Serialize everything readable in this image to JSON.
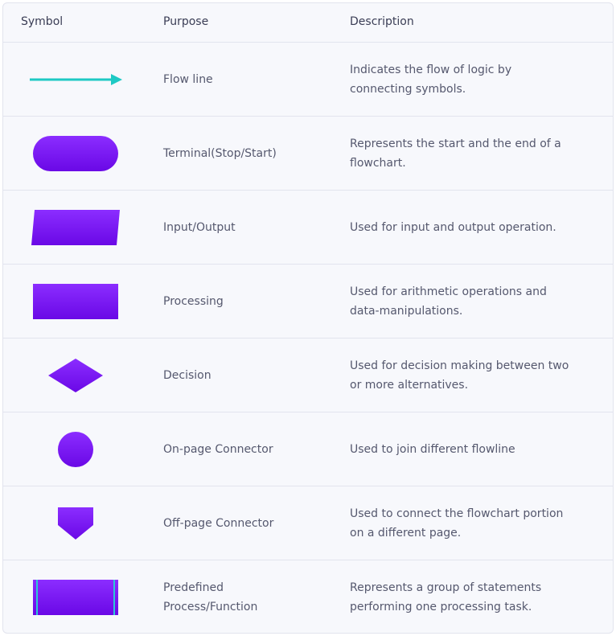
{
  "table": {
    "headers": {
      "symbol": "Symbol",
      "purpose": "Purpose",
      "description": "Description"
    },
    "rows": [
      {
        "symbol_icon": "flow-line-arrow-icon",
        "purpose": [
          "Flow line"
        ],
        "description": [
          "Indicates the flow of logic by",
          "connecting symbols."
        ]
      },
      {
        "symbol_icon": "terminal-icon",
        "purpose": [
          "Terminal(Stop/Start)"
        ],
        "description": [
          "Represents the start and the end of a",
          "flowchart."
        ]
      },
      {
        "symbol_icon": "input-output-icon",
        "purpose": [
          "Input/Output"
        ],
        "description": [
          "Used for input and output operation."
        ]
      },
      {
        "symbol_icon": "processing-icon",
        "purpose": [
          "Processing"
        ],
        "description": [
          "Used for arithmetic operations and",
          "data-manipulations."
        ]
      },
      {
        "symbol_icon": "decision-icon",
        "purpose": [
          "Decision"
        ],
        "description": [
          "Used for decision making between two",
          "or more alternatives."
        ]
      },
      {
        "symbol_icon": "on-page-connector-icon",
        "purpose": [
          "On-page Connector"
        ],
        "description": [
          "Used to join different flowline"
        ]
      },
      {
        "symbol_icon": "off-page-connector-icon",
        "purpose": [
          "Off-page Connector"
        ],
        "description": [
          "Used to connect the flowchart portion",
          "on a different page."
        ]
      },
      {
        "symbol_icon": "predefined-process-icon",
        "purpose": [
          "Predefined",
          "Process/Function"
        ],
        "description": [
          "Represents a group of statements",
          "performing one processing task."
        ]
      }
    ]
  },
  "colors": {
    "arrow": "#1ec9c4",
    "shape_top": "#8b2dff",
    "shape_bottom": "#6a08e6",
    "predefined_side_lines": "#2bc9d6"
  }
}
